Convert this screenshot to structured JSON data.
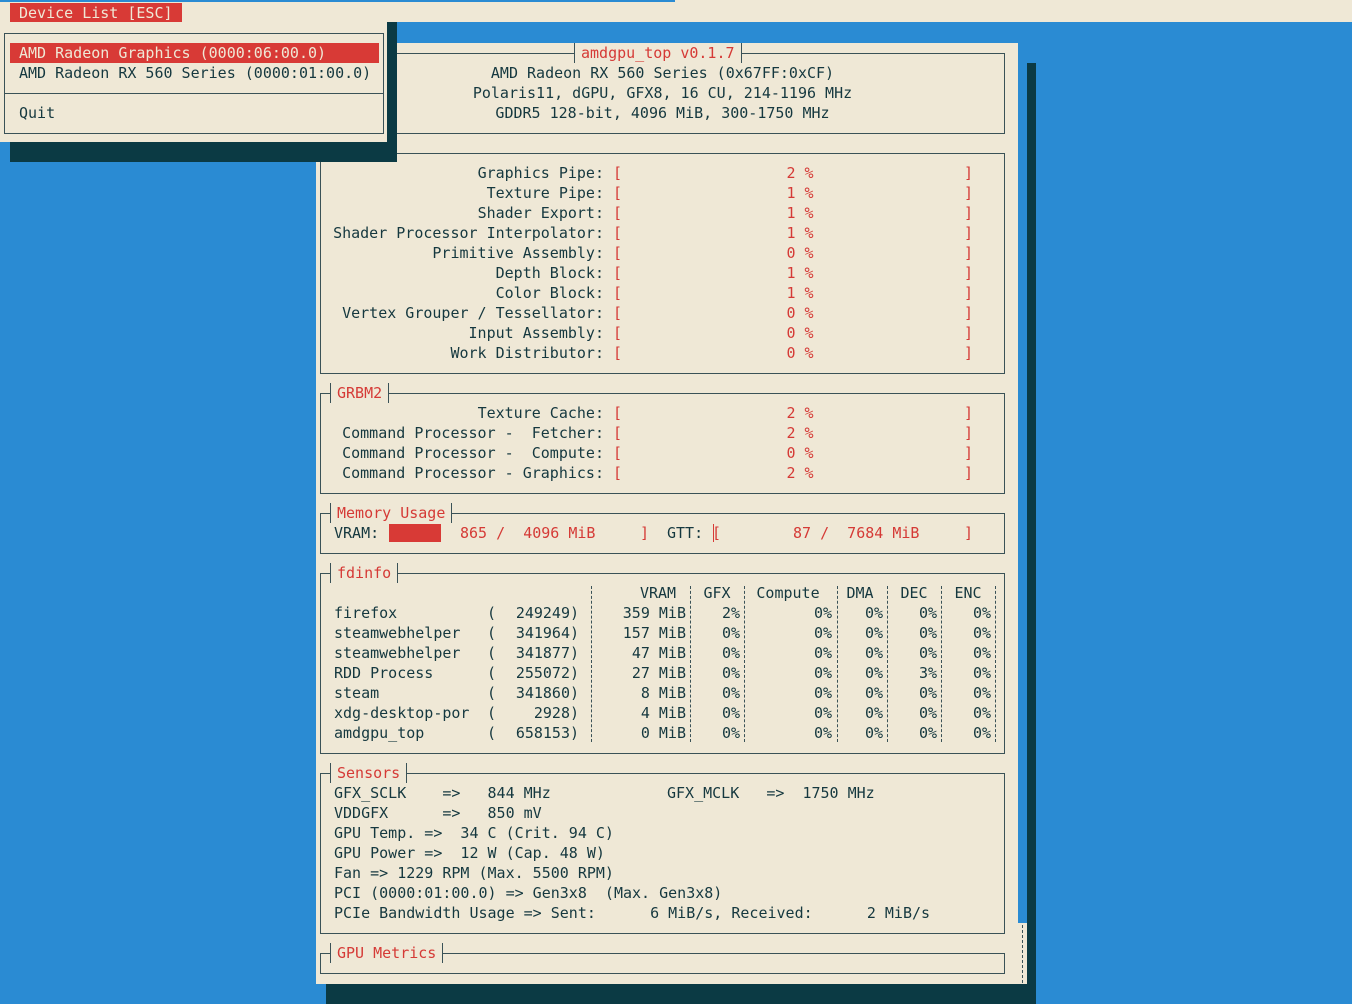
{
  "menubar": {
    "device_list_label": "Device List [ESC]"
  },
  "device_menu": {
    "items": [
      "AMD Radeon Graphics (0000:06:00.0)",
      "AMD Radeon RX 560 Series (0000:01:00.0)"
    ],
    "quit_label": "Quit"
  },
  "header": {
    "title": "amdgpu_top v0.1.7",
    "line1": "AMD Radeon RX 560 Series (0x67FF:0xCF)",
    "line2": "Polaris11, dGPU, GFX8, 16 CU, 214-1196 MHz",
    "line3": "GDDR5 128-bit, 4096 MiB, 300-1750 MHz"
  },
  "grbm": {
    "rows": [
      {
        "label": "Graphics Pipe:",
        "value": "2 %",
        "percent": 2
      },
      {
        "label": "Texture Pipe:",
        "value": "1 %",
        "percent": 1
      },
      {
        "label": "Shader Export:",
        "value": "1 %",
        "percent": 1
      },
      {
        "label": "Shader Processor Interpolator:",
        "value": "1 %",
        "percent": 1
      },
      {
        "label": "Primitive Assembly:",
        "value": "0 %",
        "percent": 0
      },
      {
        "label": "Depth Block:",
        "value": "1 %",
        "percent": 1
      },
      {
        "label": "Color Block:",
        "value": "1 %",
        "percent": 1
      },
      {
        "label": "Vertex Grouper / Tessellator:",
        "value": "0 %",
        "percent": 0
      },
      {
        "label": "Input Assembly:",
        "value": "0 %",
        "percent": 0
      },
      {
        "label": "Work Distributor:",
        "value": "0 %",
        "percent": 0
      }
    ]
  },
  "grbm2": {
    "title": "GRBM2",
    "rows": [
      {
        "label": "Texture Cache:",
        "value": "2 %",
        "percent": 2
      },
      {
        "label": "Command Processor -  Fetcher:",
        "value": "2 %",
        "percent": 2
      },
      {
        "label": "Command Processor -  Compute:",
        "value": "0 %",
        "percent": 0
      },
      {
        "label": "Command Processor - Graphics:",
        "value": "2 %",
        "percent": 2
      }
    ]
  },
  "memory": {
    "title": "Memory Usage",
    "vram_label": "VRAM:",
    "vram_value": "865 /  4096 MiB",
    "vram_used_fraction": 0.211,
    "gtt_label": "GTT:",
    "gtt_value": "87 /  7684 MiB",
    "gtt_used_fraction": 0.011
  },
  "fdinfo": {
    "title": "fdinfo",
    "headers": [
      "VRAM",
      "GFX",
      "Compute",
      "DMA",
      "DEC",
      "ENC"
    ],
    "rows": [
      {
        "name": "firefox",
        "pid": "249249",
        "vram": "359 MiB",
        "gfx": "2%",
        "compute": "0%",
        "dma": "0%",
        "dec": "0%",
        "enc": "0%"
      },
      {
        "name": "steamwebhelper",
        "pid": "341964",
        "vram": "157 MiB",
        "gfx": "0%",
        "compute": "0%",
        "dma": "0%",
        "dec": "0%",
        "enc": "0%"
      },
      {
        "name": "steamwebhelper",
        "pid": "341877",
        "vram": "47 MiB",
        "gfx": "0%",
        "compute": "0%",
        "dma": "0%",
        "dec": "0%",
        "enc": "0%"
      },
      {
        "name": "RDD Process",
        "pid": "255072",
        "vram": "27 MiB",
        "gfx": "0%",
        "compute": "0%",
        "dma": "0%",
        "dec": "3%",
        "enc": "0%"
      },
      {
        "name": "steam",
        "pid": "341860",
        "vram": "8 MiB",
        "gfx": "0%",
        "compute": "0%",
        "dma": "0%",
        "dec": "0%",
        "enc": "0%"
      },
      {
        "name": "xdg-desktop-por",
        "pid": "2928",
        "vram": "4 MiB",
        "gfx": "0%",
        "compute": "0%",
        "dma": "0%",
        "dec": "0%",
        "enc": "0%"
      },
      {
        "name": "amdgpu_top",
        "pid": "658153",
        "vram": "0 MiB",
        "gfx": "0%",
        "compute": "0%",
        "dma": "0%",
        "dec": "0%",
        "enc": "0%"
      }
    ]
  },
  "sensors": {
    "title": "Sensors",
    "gfx_sclk": "GFX_SCLK    =>   844 MHz",
    "gfx_mclk": "GFX_MCLK   =>  1750 MHz",
    "vddgfx": "VDDGFX      =>   850 mV",
    "temp": "GPU Temp. =>  34 C (Crit. 94 C)",
    "power": "GPU Power =>  12 W (Cap. 48 W)",
    "fan": "Fan => 1229 RPM (Max. 5500 RPM)",
    "pci": "PCI (0000:01:00.0) => Gen3x8  (Max. Gen3x8)",
    "pcie_bw": "PCIe Bandwidth Usage => Sent:      6 MiB/s, Received:      2 MiB/s"
  },
  "gpu_metrics": {
    "title": "GPU Metrics"
  }
}
